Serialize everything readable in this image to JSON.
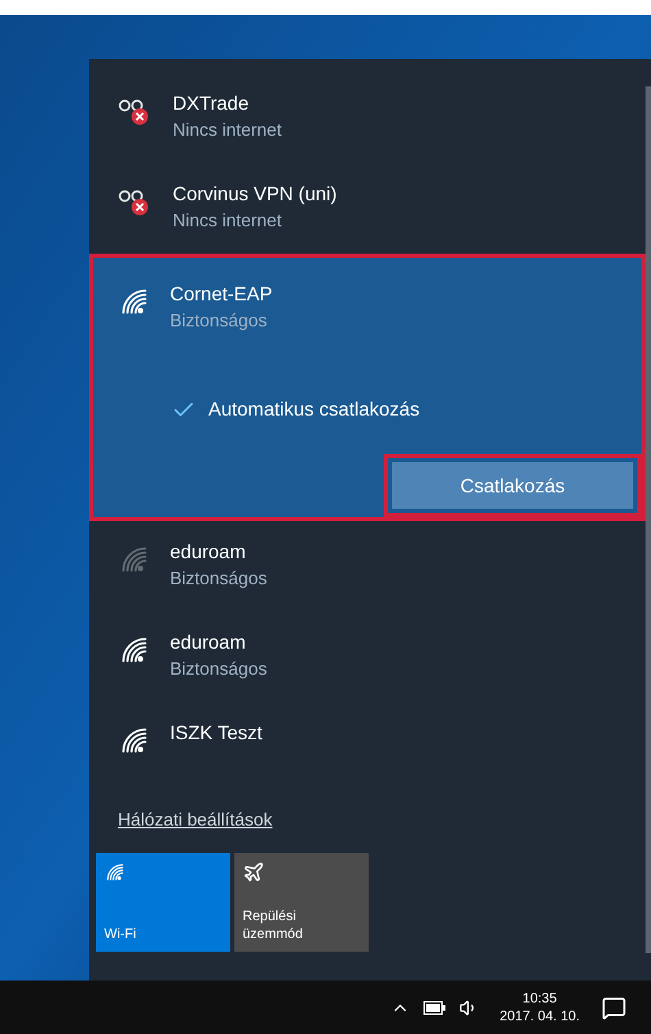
{
  "networks": [
    {
      "kind": "vpn",
      "name": "DXTrade",
      "status": "Nincs internet",
      "selected": false
    },
    {
      "kind": "vpn",
      "name": "Corvinus VPN (uni)",
      "status": "Nincs internet",
      "selected": false
    },
    {
      "kind": "wifi",
      "name": "Cornet-EAP",
      "status": "Biztonságos",
      "selected": true,
      "weak": false,
      "outlined": true,
      "auto_connect": {
        "label": "Automatikus csatlakozás",
        "checked": true
      },
      "connect_button": {
        "label": "Csatlakozás",
        "outlined": true
      }
    },
    {
      "kind": "wifi",
      "name": "eduroam",
      "status": "Biztonságos",
      "selected": false,
      "weak": true
    },
    {
      "kind": "wifi",
      "name": "eduroam",
      "status": "Biztonságos",
      "selected": false,
      "weak": false
    },
    {
      "kind": "wifi",
      "name": "ISZK Teszt",
      "selected": false,
      "weak": false
    }
  ],
  "settings_link": "Hálózati beállítások",
  "quick_actions": [
    {
      "kind": "wifi",
      "label": "Wi-Fi",
      "on": true
    },
    {
      "kind": "airplane",
      "label": "Repülési üzemmód",
      "on": false
    }
  ],
  "taskbar": {
    "time": "10:35",
    "date": "2017. 04. 10."
  }
}
